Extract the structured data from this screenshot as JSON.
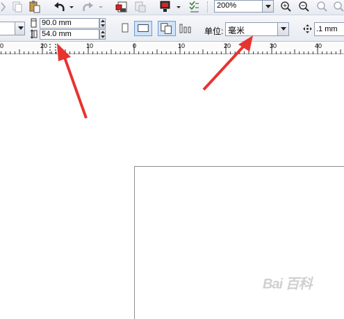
{
  "toolbar": {
    "zoom_value": "200%",
    "icons": [
      "copy-icon",
      "paste-icon",
      "undo-icon",
      "redo-icon",
      "import-icon",
      "export-icon",
      "publish-icon",
      "options-icon",
      "zoom-in-icon",
      "zoom-out-icon",
      "zoom-fit-icon",
      "zoom-page-icon"
    ]
  },
  "property_bar": {
    "width_value": "90.0 mm",
    "height_value": "54.0 mm",
    "units_label": "单位:",
    "units_value": "毫米",
    "nudge_value": ".1 mm"
  },
  "ruler": {
    "ticks": [
      "0",
      "20",
      "10",
      "0",
      "10",
      "20",
      "30",
      "40"
    ]
  },
  "annotation": {
    "arrow_color": "#e8332f"
  },
  "watermark": {
    "text": "Bai 百科"
  },
  "colors": {
    "toolbar_bg": "#eceff4",
    "field_border": "#8e9ab0",
    "active_button": "#cfe3f8"
  }
}
